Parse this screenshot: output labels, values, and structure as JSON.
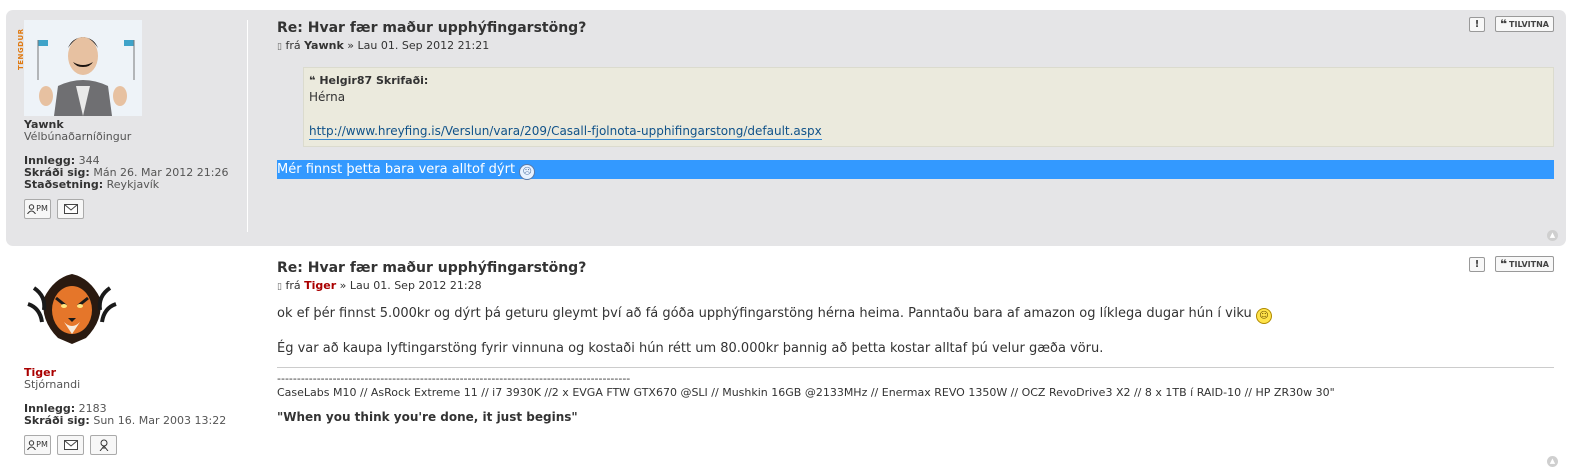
{
  "posts": [
    {
      "profile": {
        "rank_tag": "TENGDUR",
        "username": "Yawnk",
        "rank": "Vélbúnaðarníðingur",
        "stats": [
          {
            "label": "Innlegg:",
            "value": "344"
          },
          {
            "label": "Skráði sig:",
            "value": "Mán 26. Mar 2012 21:26"
          },
          {
            "label": "Staðsetning:",
            "value": "Reykjavík"
          }
        ],
        "pm_label": "PM"
      },
      "title": "Re: Hvar fær maður upphýfingarstöng?",
      "by": "frá",
      "author": "Yawnk",
      "date_sep": "»",
      "date": "Lau 01. Sep 2012 21:21",
      "quote": {
        "cite": "Helgir87 Skrifaði:",
        "text": "Hérna",
        "link": "http://www.hreyfing.is/Verslun/vara/209/Casall-fjolnota-upphifingarstong/default.aspx"
      },
      "body_selected": "Mér finnst þetta bara vera alltof dýrt",
      "actions": {
        "report": "!",
        "quote": "TILVITNA"
      }
    },
    {
      "profile": {
        "username": "Tiger",
        "rank": "Stjórnandi",
        "stats": [
          {
            "label": "Innlegg:",
            "value": "2183"
          },
          {
            "label": "Skráði sig:",
            "value": "Sun 16. Mar 2003 13:22"
          }
        ],
        "pm_label": "PM"
      },
      "title": "Re: Hvar fær maður upphýfingarstöng?",
      "by": "frá",
      "author": "Tiger",
      "date_sep": "»",
      "date": "Lau 01. Sep 2012 21:28",
      "body": [
        "ok ef þér finnst 5.000kr og dýrt þá geturu gleymt því að fá góða upphýfingarstöng hérna heima. Panntaðu bara af amazon og líklega dugar hún í viku",
        "Ég var að kaupa lyftingarstöng fyrir vinnuna og kostaði hún rétt um 80.000kr þannig að þetta kostar alltaf þú velur gæða vöru."
      ],
      "signature": {
        "dashes": "-----------------------------------------------------------------------------------------",
        "specs": "CaseLabs M10 // AsRock Extreme 11 // i7 3930K //2 x EVGA FTW GTX670 @SLI // Mushkin 16GB @2133MHz // Enermax REVO 1350W // OCZ RevoDrive3 X2 // 8 x 1TB í RAID-10 // HP ZR30w 30\"",
        "motto": "\"When you think you're done, it just begins\""
      },
      "actions": {
        "report": "!",
        "quote": "TILVITNA"
      }
    }
  ],
  "colors": {
    "post_bg_1": "#e5e5e7",
    "selection": "#3399ff",
    "moderator_name": "#aa0000",
    "quote_bg": "#ebeadd",
    "link": "#105289"
  }
}
